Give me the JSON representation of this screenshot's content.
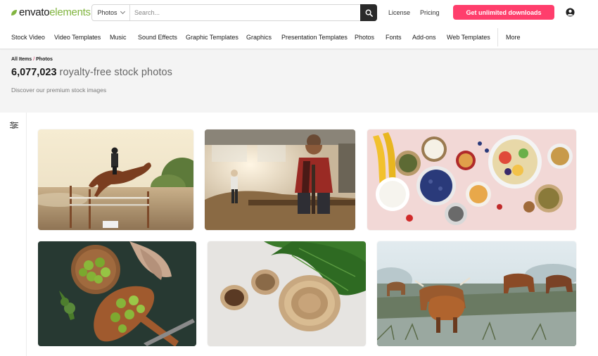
{
  "header": {
    "logo_part1": "envato",
    "logo_part2": "elements",
    "search_scope": "Photos",
    "search_placeholder": "Search...",
    "license_label": "License",
    "pricing_label": "Pricing",
    "cta_label": "Get unlimited downloads",
    "cta_color": "#ff3e6c",
    "brand_color": "#82b541",
    "icons": {
      "search": "search-icon",
      "user": "user-icon",
      "chevron": "chevron-down-icon"
    }
  },
  "nav": {
    "items": [
      "Stock Video",
      "Video Templates",
      "Music",
      "Sound Effects",
      "Graphic Templates",
      "Graphics",
      "Presentation Templates",
      "Photos",
      "Fonts",
      "Add-ons",
      "Web Templates"
    ],
    "more_label": "More"
  },
  "hero": {
    "crumb_all": "All Items",
    "crumb_sep": "/",
    "crumb_current": "Photos",
    "count": "6,077,023",
    "headline_rest": "royalty-free stock photos",
    "subtitle": "Discover our premium stock images"
  },
  "results": {
    "filter_icon": "filter-sliders-icon",
    "photos": [
      {
        "subject": "horse-jumping"
      },
      {
        "subject": "skateboarder"
      },
      {
        "subject": "breakfast-spread"
      },
      {
        "subject": "brussels-sprouts"
      },
      {
        "subject": "wooden-bowls"
      },
      {
        "subject": "highland-cattle"
      }
    ]
  }
}
